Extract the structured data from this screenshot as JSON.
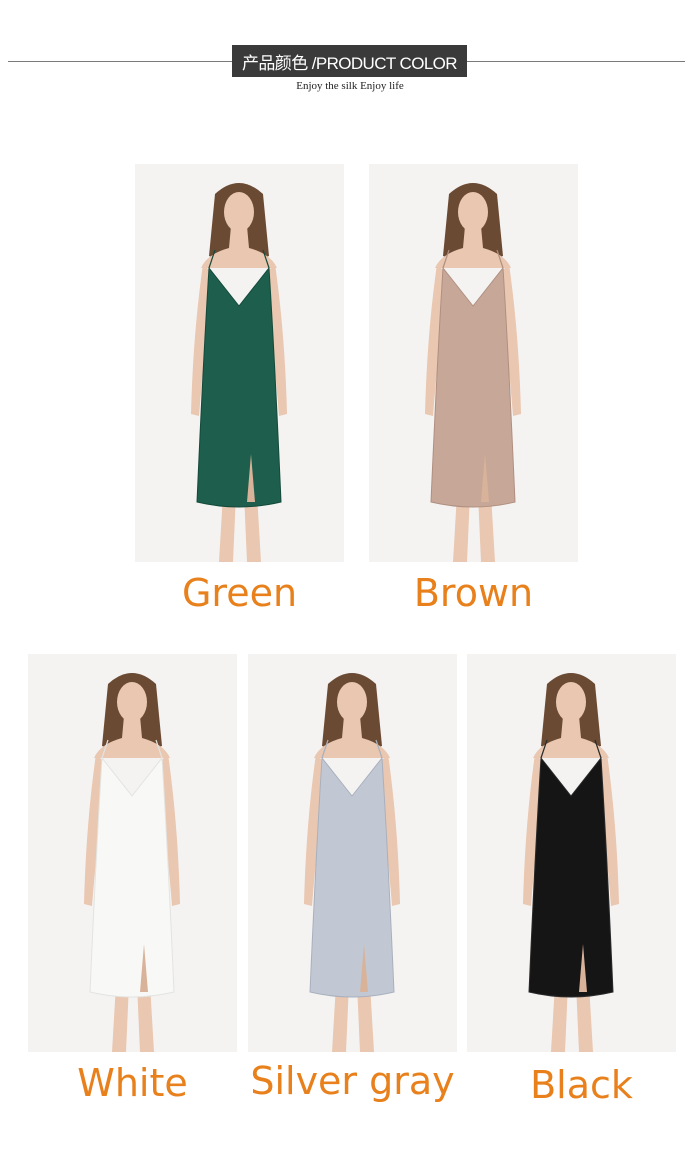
{
  "header": {
    "title": "产品颜色 /PRODUCT COLOR",
    "subtitle": "Enjoy the silk  Enjoy life"
  },
  "products": [
    {
      "label": "Green",
      "dress_color": "#1d5e4c",
      "shade": "#154a3b"
    },
    {
      "label": "Brown",
      "dress_color": "#c7a898",
      "shade": "#b08f80"
    },
    {
      "label": "White",
      "dress_color": "#f8f8f6",
      "shade": "#e3e3e0"
    },
    {
      "label": "Silver gray",
      "dress_color": "#c2c8d3",
      "shade": "#a9b0bd"
    },
    {
      "label": "Black",
      "dress_color": "#151515",
      "shade": "#2a2a2a"
    }
  ],
  "colors": {
    "label_text": "#e8801c",
    "banner_bg": "#3a3a3a",
    "photo_bg": "#f4f3f2"
  }
}
